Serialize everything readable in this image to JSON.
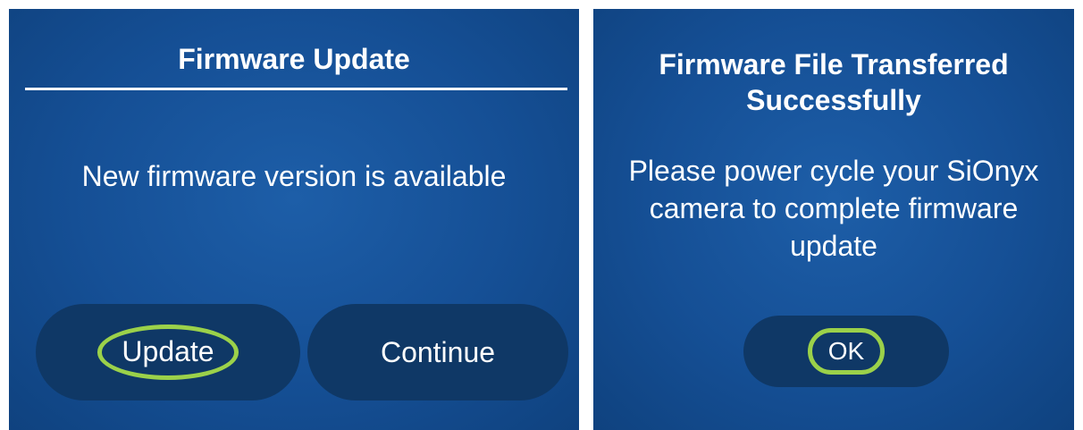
{
  "dialog_update": {
    "title": "Firmware Update",
    "message": "New firmware version is available",
    "update_label": "Update",
    "continue_label": "Continue"
  },
  "dialog_transferred": {
    "title": "Firmware File Transferred Successfully",
    "message": "Please power cycle your SiOnyx camera to complete firmware update",
    "ok_label": "OK"
  },
  "colors": {
    "panel_blue": "#154f95",
    "button_dark": "#0f3866",
    "highlight_green": "#9bd14a",
    "text": "#ffffff"
  }
}
